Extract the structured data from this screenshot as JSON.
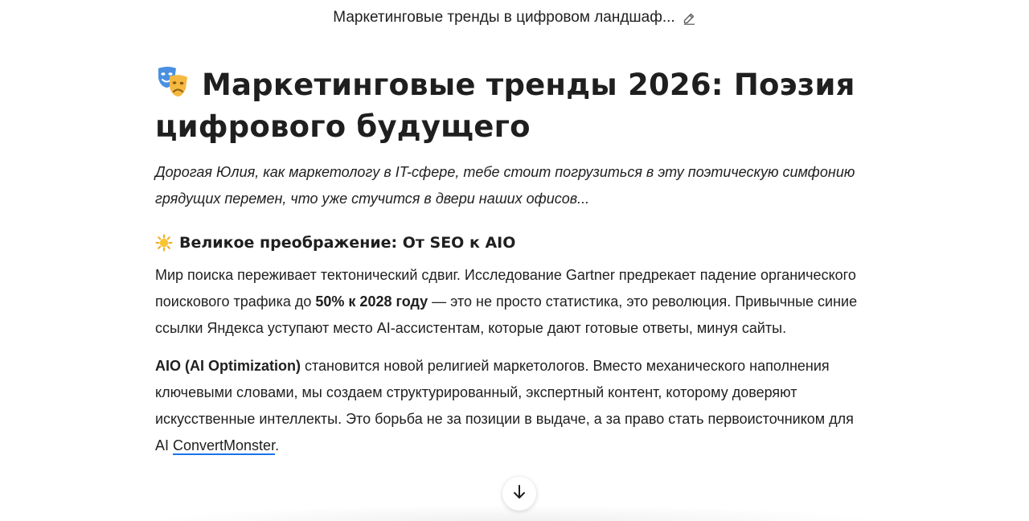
{
  "header": {
    "title": "Маркетинговые тренды в цифровом ландшаф..."
  },
  "article": {
    "title": "Маркетинговые тренды 2026: Поэзия цифрового будущего",
    "intro": "Дорогая Юлия, как маркетологу в IT-сфере, тебе стоит погрузиться в эту поэтическую симфонию грядущих перемен, что уже стучится в двери наших офисов...",
    "section1": {
      "heading": "Великое преображение: От SEO к AIO",
      "p1": {
        "before": "Мир поиска переживает тектонический сдвиг. Исследование Gartner предрекает падение органического поискового трафика до ",
        "bold": "50% к 2028 году",
        "after": " — это не просто статистика, это революция. Привычные синие ссылки Яндекса уступают место AI-ассистентам, которые дают готовые ответы, минуя сайты."
      },
      "p2": {
        "bold": "AIO (AI Optimization)",
        "after": " становится новой религией маркетологов. Вместо механического наполнения ключевыми словами, мы создаем структурированный, экспертный контент, которому доверяют искусственные интеллекты. Это борьба не за позиции в выдаче, а за право стать первоисточником для AI ",
        "link": "ConvertMonster",
        "end": "."
      }
    }
  },
  "icons": {
    "title_icon": "performing-arts-masks-icon",
    "edit_icon": "pencil-icon",
    "section_icon": "sun-icon",
    "scroll_icon": "arrow-down-icon"
  },
  "colors": {
    "text": "#1f1f1f",
    "link_underline": "#1a73e8",
    "background": "#ffffff"
  }
}
